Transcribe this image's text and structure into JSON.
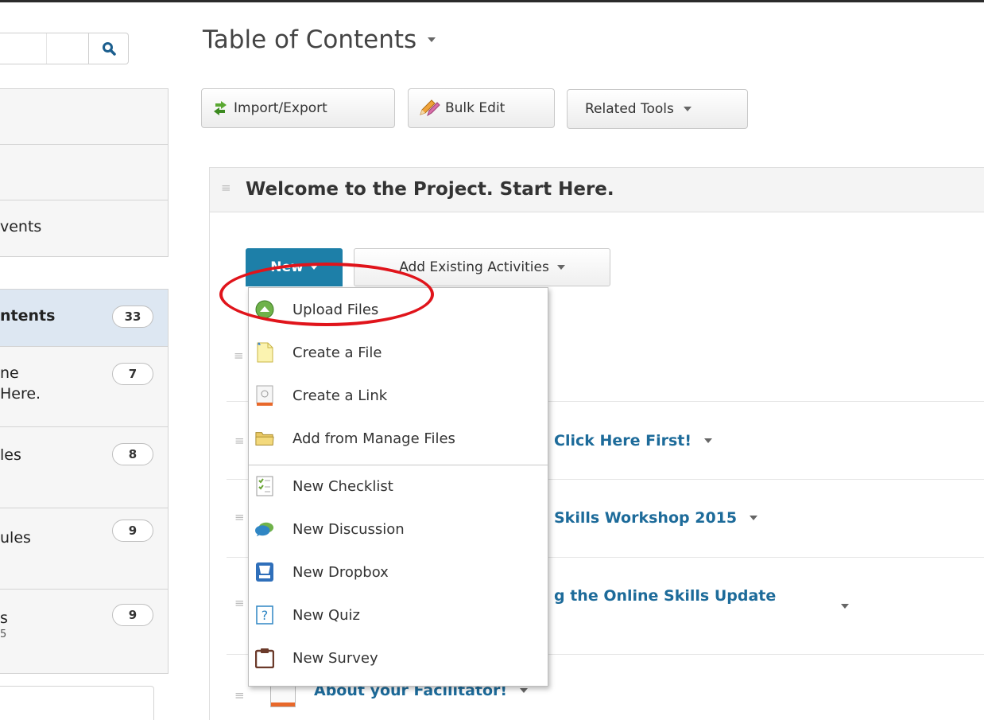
{
  "sidebar": {
    "nav": [
      {
        "label": ""
      },
      {
        "label": ""
      },
      {
        "label": "vents"
      }
    ],
    "toc": [
      {
        "line1": "ntents",
        "count": "33"
      },
      {
        "line1": "ne",
        "line2": "Here.",
        "count": "7"
      },
      {
        "line1": "les",
        "count": "8"
      },
      {
        "line1": "ules",
        "count": "9"
      },
      {
        "line1": "s",
        "line3": "5",
        "count": "9"
      }
    ]
  },
  "header": {
    "title": "Table of Contents"
  },
  "toolbar": {
    "import_export": "Import/Export",
    "bulk_edit": "Bulk Edit",
    "related_tools": "Related Tools"
  },
  "module": {
    "title": "Welcome to the Project. Start Here.",
    "new_label": "New",
    "add_existing_label": "Add Existing Activities",
    "topics": [
      {
        "label": "Click Here First!"
      },
      {
        "label": "Skills Workshop 2015"
      },
      {
        "label": "g the Online Skills Update"
      },
      {
        "label": "About your Facilitator!"
      }
    ]
  },
  "dropdown": {
    "items": [
      {
        "label": "Upload Files",
        "icon": "upload-icon"
      },
      {
        "label": "Create a File",
        "icon": "new-file-icon"
      },
      {
        "label": "Create a Link",
        "icon": "link-icon"
      },
      {
        "label": "Add from Manage Files",
        "icon": "folder-icon"
      },
      {
        "label": "New Checklist",
        "icon": "checklist-icon"
      },
      {
        "label": "New Discussion",
        "icon": "discussion-icon"
      },
      {
        "label": "New Dropbox",
        "icon": "dropbox-icon"
      },
      {
        "label": "New Quiz",
        "icon": "quiz-icon"
      },
      {
        "label": "New Survey",
        "icon": "survey-icon"
      }
    ]
  },
  "colors": {
    "accent": "#1d7fa8",
    "link": "#1d6b9a",
    "highlight": "#e0141b",
    "selected_row": "#dde7f2"
  }
}
